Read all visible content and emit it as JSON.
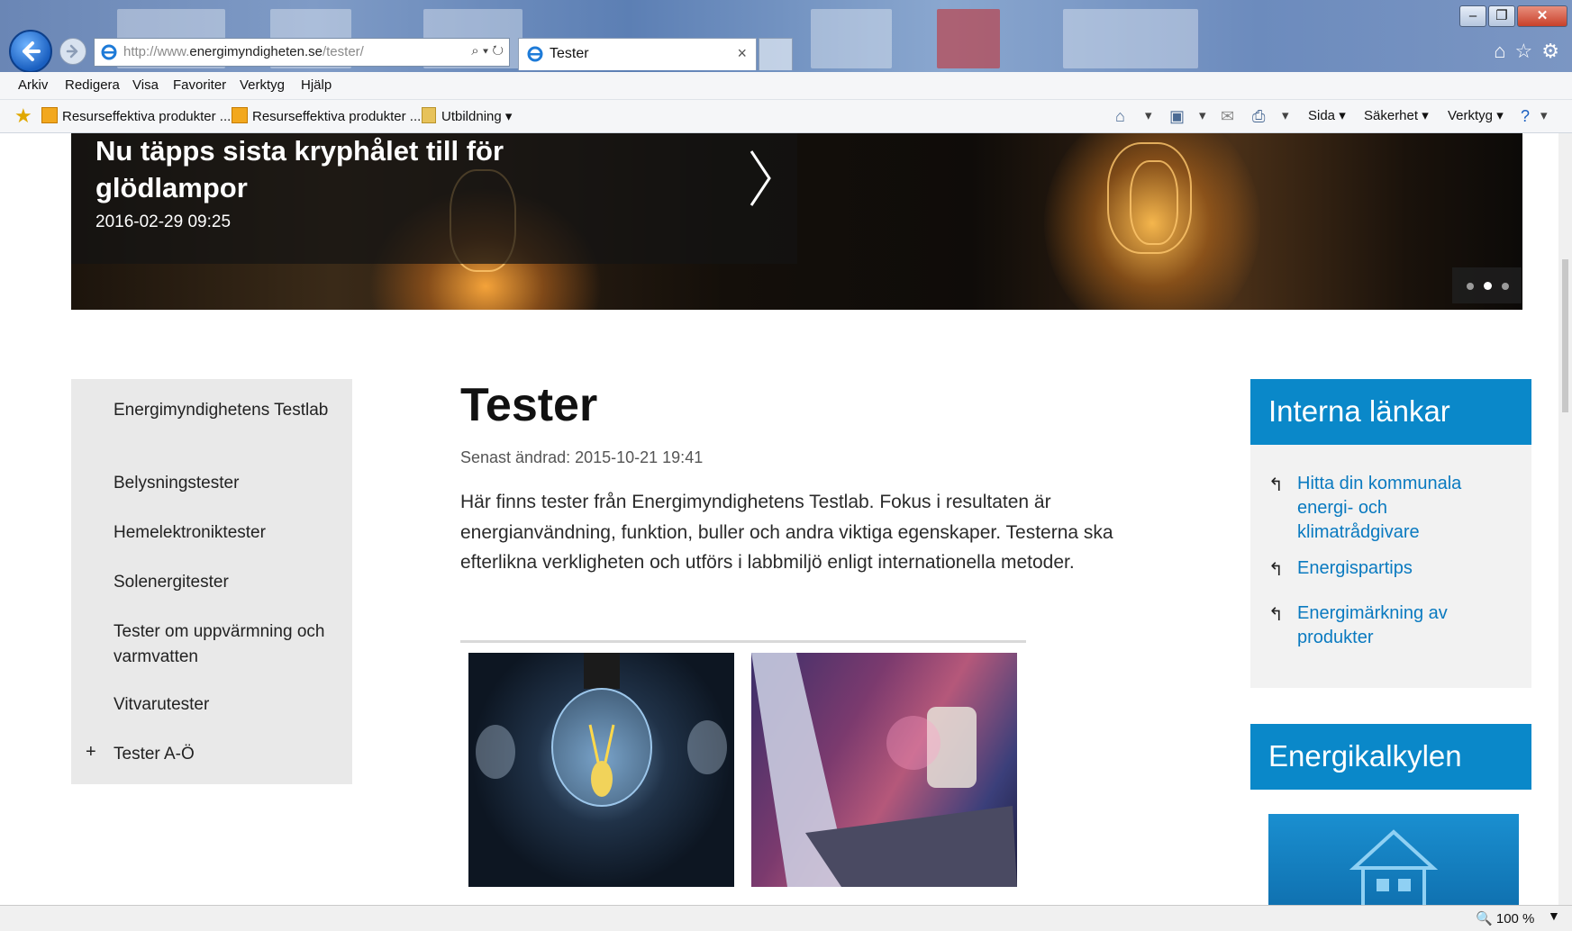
{
  "browser": {
    "url_prefix": "http://www.",
    "url_domain": "energimyndigheten.se",
    "url_path": "/tester/",
    "tab_title": "Tester",
    "tab_close": "×",
    "menu": [
      "Arkiv",
      "Redigera",
      "Visa",
      "Favoriter",
      "Verktyg",
      "Hjälp"
    ],
    "favorites": [
      "Resurseffektiva produkter ...",
      "Resurseffektiva produkter ...",
      "Utbildning ▾"
    ],
    "commands": {
      "sida": "Sida ▾",
      "sakerhet": "Säkerhet ▾",
      "verktyg": "Verktyg ▾"
    },
    "zoom": "100 %"
  },
  "hero": {
    "title": "Nu täpps sista kryphålet till för glödlampor",
    "date": "2016-02-29 09:25",
    "active_slide": 2,
    "slide_count": 3
  },
  "leftnav": {
    "items": [
      "Energimyndighetens Testlab",
      "Belysningstester",
      "Hemelektroniktester",
      "Solenergitester",
      "Tester om uppvärmning och varmvatten",
      "Vitvarutester",
      "Tester A-Ö"
    ],
    "expand_symbol": "+"
  },
  "main": {
    "title": "Tester",
    "modified": "Senast ändrad: 2015-10-21 19:41",
    "intro": "Här finns tester från Energimyndighetens Testlab. Fokus i resultaten är energianvändning, funktion, buller och andra viktiga egenskaper. Testerna ska efterlikna verkligheten och utförs i labbmiljö enligt internationella metoder."
  },
  "sidebar": {
    "internal_links_title": "Interna länkar",
    "links": [
      "Hitta din kommunala energi- och klimatrådgivare",
      "Energispartips",
      "Energimärkning av produkter"
    ],
    "calc_title": "Energikalkylen"
  },
  "icons": {
    "back": "back-arrow-icon",
    "forward": "forward-arrow-icon",
    "home": "home-icon",
    "favorites": "star-icon",
    "settings": "gear-icon",
    "search": "search-icon",
    "refresh": "refresh-icon",
    "link": "link-arrow-icon"
  },
  "colors": {
    "accent_blue": "#0a88c9",
    "link_blue": "#0a7ac0",
    "nav_bg": "#e9e9e9"
  }
}
